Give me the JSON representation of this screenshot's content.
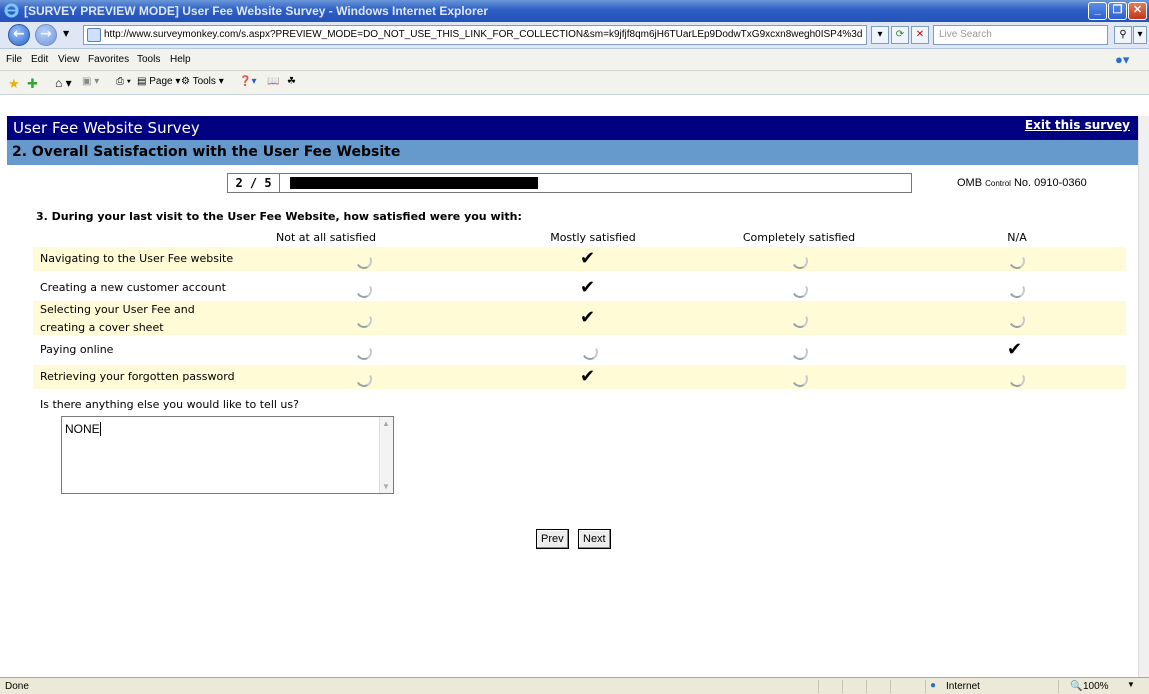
{
  "window": {
    "title": "[SURVEY PREVIEW MODE] User Fee Website Survey - Windows Internet Explorer"
  },
  "address": {
    "url": "http://www.surveymonkey.com/s.aspx?PREVIEW_MODE=DO_NOT_USE_THIS_LINK_FOR_COLLECTION&sm=k9jfjf8qm6jH6TUarLEp9DodwTxG9xcxn8wegh0ISP4%3d",
    "search_placeholder": "Live Search"
  },
  "menu": [
    "File",
    "Edit",
    "View",
    "Favorites",
    "Tools",
    "Help"
  ],
  "toolbar": {
    "page": "Page",
    "tools": "Tools"
  },
  "survey": {
    "title": "User Fee Website Survey",
    "exit_link": "Exit this survey",
    "page_title": "2. Overall Satisfaction with the User Fee Website",
    "progress_label": "2 / 5",
    "progress_fraction": 0.4,
    "omb_prefix": "OMB",
    "omb_small": "Control",
    "omb_number": "No. 0910-0360",
    "question": "3. During your last visit to the User Fee Website, how satisfied were you with:",
    "columns": [
      "Not at all satisfied",
      "Mostly satisfied",
      "Completely satisfied",
      "N/A"
    ],
    "rows": [
      {
        "label": "Navigating to the User Fee website",
        "selected": 1
      },
      {
        "label": "Creating a new customer account",
        "selected": 1
      },
      {
        "label": "Selecting your User Fee and creating a cover sheet",
        "selected": 1
      },
      {
        "label": "Paying online",
        "selected": 3
      },
      {
        "label": "Retrieving your forgotten password",
        "selected": 1
      }
    ],
    "comment_prompt": "Is there anything else you would like to tell us?",
    "comment_value": "NONE",
    "prev_label": "Prev",
    "next_label": "Next"
  },
  "status": {
    "left": "Done",
    "zone": "Internet",
    "zoom": "100%"
  }
}
